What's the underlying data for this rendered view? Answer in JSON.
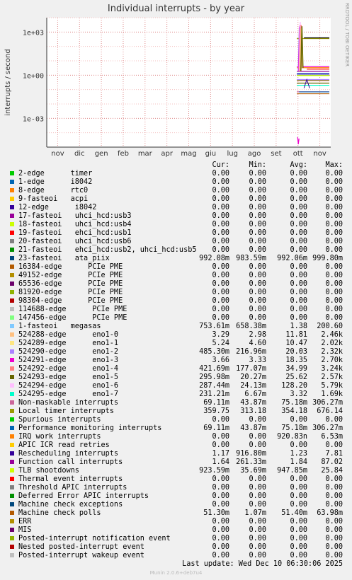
{
  "chart_data": {
    "type": "line",
    "title": "Individual interrupts - by year",
    "ylabel": "interrupts / second",
    "yscale": "log",
    "yticks": [
      "1e+03",
      "1e+00",
      "1e-03"
    ],
    "x_ticks": [
      "nov",
      "dic",
      "gen",
      "feb",
      "mar",
      "apr",
      "mag",
      "giu",
      "lug",
      "ago",
      "set",
      "ott",
      "nov"
    ],
    "grid": true,
    "note": "Data exists only from mid-ott onwards"
  },
  "side_label": "RRDTOOL / TOBI OETIKER",
  "columns": [
    "Cur:",
    "Min:",
    "Avg:",
    "Max:"
  ],
  "legend": [
    {
      "name": "2-edge      timer",
      "color": "#00cc00",
      "cur": "0.00",
      "min": "0.00",
      "avg": "0.00",
      "max": "0.00"
    },
    {
      "name": "1-edge      i8042",
      "color": "#0066b3",
      "cur": "0.00",
      "min": "0.00",
      "avg": "0.00",
      "max": "0.00"
    },
    {
      "name": "8-edge      rtc0",
      "color": "#ff8000",
      "cur": "0.00",
      "min": "0.00",
      "avg": "0.00",
      "max": "0.00"
    },
    {
      "name": "9-fasteoi   acpi",
      "color": "#ffcc00",
      "cur": "0.00",
      "min": "0.00",
      "avg": "0.00",
      "max": "0.00"
    },
    {
      "name": "12-edge      i8042",
      "color": "#330099",
      "cur": "0.00",
      "min": "0.00",
      "avg": "0.00",
      "max": "0.00"
    },
    {
      "name": "17-fasteoi   uhci_hcd:usb3",
      "color": "#990099",
      "cur": "0.00",
      "min": "0.00",
      "avg": "0.00",
      "max": "0.00"
    },
    {
      "name": "18-fasteoi   uhci_hcd:usb4",
      "color": "#ccff00",
      "cur": "0.00",
      "min": "0.00",
      "avg": "0.00",
      "max": "0.00"
    },
    {
      "name": "19-fasteoi   ehci_hcd:usb1",
      "color": "#ff0000",
      "cur": "0.00",
      "min": "0.00",
      "avg": "0.00",
      "max": "0.00"
    },
    {
      "name": "20-fasteoi   uhci_hcd:usb6",
      "color": "#808080",
      "cur": "0.00",
      "min": "0.00",
      "avg": "0.00",
      "max": "0.00"
    },
    {
      "name": "21-fasteoi   ehci_hcd:usb2, uhci_hcd:usb5",
      "color": "#008f00",
      "cur": "0.00",
      "min": "0.00",
      "avg": "0.00",
      "max": "0.00"
    },
    {
      "name": "23-fasteoi   ata_piix",
      "color": "#00487d",
      "cur": "992.08m",
      "min": "983.59m",
      "avg": "992.06m",
      "max": "999.80m"
    },
    {
      "name": "16384-edge      PCIe PME",
      "color": "#b35a00",
      "cur": "0.00",
      "min": "0.00",
      "avg": "0.00",
      "max": "0.00"
    },
    {
      "name": "49152-edge      PCIe PME",
      "color": "#b38f00",
      "cur": "0.00",
      "min": "0.00",
      "avg": "0.00",
      "max": "0.00"
    },
    {
      "name": "65536-edge      PCIe PME",
      "color": "#6b006b",
      "cur": "0.00",
      "min": "0.00",
      "avg": "0.00",
      "max": "0.00"
    },
    {
      "name": "81920-edge      PCIe PME",
      "color": "#8fb300",
      "cur": "0.00",
      "min": "0.00",
      "avg": "0.00",
      "max": "0.00"
    },
    {
      "name": "98304-edge      PCIe PME",
      "color": "#b30000",
      "cur": "0.00",
      "min": "0.00",
      "avg": "0.00",
      "max": "0.00"
    },
    {
      "name": "114688-edge      PCIe PME",
      "color": "#bebebe",
      "cur": "0.00",
      "min": "0.00",
      "avg": "0.00",
      "max": "0.00"
    },
    {
      "name": "147456-edge      PCIe PME",
      "color": "#80ff80",
      "cur": "0.00",
      "min": "0.00",
      "avg": "0.00",
      "max": "0.00"
    },
    {
      "name": "1-fasteoi   megasas",
      "color": "#80c9ff",
      "cur": "753.61m",
      "min": "658.38m",
      "avg": "1.38",
      "max": "200.60"
    },
    {
      "name": "524288-edge      eno1-0",
      "color": "#ffc080",
      "cur": "3.29",
      "min": "2.98",
      "avg": "11.81",
      "max": "2.46k"
    },
    {
      "name": "524289-edge      eno1-1",
      "color": "#ffe680",
      "cur": "5.24",
      "min": "4.60",
      "avg": "10.47",
      "max": "2.02k"
    },
    {
      "name": "524290-edge      eno1-2",
      "color": "#aa80ff",
      "cur": "485.30m",
      "min": "216.96m",
      "avg": "20.03",
      "max": "2.32k"
    },
    {
      "name": "524291-edge      eno1-3",
      "color": "#ee00cc",
      "cur": "3.66",
      "min": "3.33",
      "avg": "18.35",
      "max": "2.70k"
    },
    {
      "name": "524292-edge      eno1-4",
      "color": "#ff8080",
      "cur": "421.69m",
      "min": "177.07m",
      "avg": "34.99",
      "max": "3.24k"
    },
    {
      "name": "524293-edge      eno1-5",
      "color": "#666600",
      "cur": "295.98m",
      "min": "20.27m",
      "avg": "25.62",
      "max": "2.57k"
    },
    {
      "name": "524294-edge      eno1-6",
      "color": "#ffbfff",
      "cur": "287.44m",
      "min": "24.13m",
      "avg": "128.20",
      "max": "5.79k"
    },
    {
      "name": "524295-edge      eno1-7",
      "color": "#00ffcc",
      "cur": "231.21m",
      "min": "6.67m",
      "avg": "3.32",
      "max": "1.69k"
    },
    {
      "name": "Non-maskable interrupts",
      "color": "#cc6699",
      "cur": "69.11m",
      "min": "43.87m",
      "avg": "75.18m",
      "max": "306.27m"
    },
    {
      "name": "Local timer interrupts",
      "color": "#999900",
      "cur": "359.75",
      "min": "313.18",
      "avg": "354.18",
      "max": "676.14"
    },
    {
      "name": "Spurious interrupts",
      "color": "#00cc00",
      "cur": "0.00",
      "min": "0.00",
      "avg": "0.00",
      "max": "0.00"
    },
    {
      "name": "Performance monitoring interrupts",
      "color": "#0066b3",
      "cur": "69.11m",
      "min": "43.87m",
      "avg": "75.18m",
      "max": "306.27m"
    },
    {
      "name": "IRQ work interrupts",
      "color": "#ff8000",
      "cur": "0.00",
      "min": "0.00",
      "avg": "920.83n",
      "max": "6.53m"
    },
    {
      "name": "APIC ICR read retries",
      "color": "#ffcc00",
      "cur": "0.00",
      "min": "0.00",
      "avg": "0.00",
      "max": "0.00"
    },
    {
      "name": "Rescheduling interrupts",
      "color": "#330099",
      "cur": "1.17",
      "min": "916.80m",
      "avg": "1.23",
      "max": "7.81"
    },
    {
      "name": "Function call interrupts",
      "color": "#990099",
      "cur": "1.64",
      "min": "261.33m",
      "avg": "1.84",
      "max": "87.02"
    },
    {
      "name": "TLB shootdowns",
      "color": "#ccff00",
      "cur": "923.59m",
      "min": "35.69m",
      "avg": "947.85m",
      "max": "25.84"
    },
    {
      "name": "Thermal event interrupts",
      "color": "#ff0000",
      "cur": "0.00",
      "min": "0.00",
      "avg": "0.00",
      "max": "0.00"
    },
    {
      "name": "Threshold APIC interrupts",
      "color": "#808080",
      "cur": "0.00",
      "min": "0.00",
      "avg": "0.00",
      "max": "0.00"
    },
    {
      "name": "Deferred Error APIC interrupts",
      "color": "#008f00",
      "cur": "0.00",
      "min": "0.00",
      "avg": "0.00",
      "max": "0.00"
    },
    {
      "name": "Machine check exceptions",
      "color": "#00487d",
      "cur": "0.00",
      "min": "0.00",
      "avg": "0.00",
      "max": "0.00"
    },
    {
      "name": "Machine check polls",
      "color": "#b35a00",
      "cur": "51.30m",
      "min": "1.07m",
      "avg": "51.40m",
      "max": "63.98m"
    },
    {
      "name": "ERR",
      "color": "#b38f00",
      "cur": "0.00",
      "min": "0.00",
      "avg": "0.00",
      "max": "0.00"
    },
    {
      "name": "MIS",
      "color": "#6b006b",
      "cur": "0.00",
      "min": "0.00",
      "avg": "0.00",
      "max": "0.00"
    },
    {
      "name": "Posted-interrupt notification event",
      "color": "#8fb300",
      "cur": "0.00",
      "min": "0.00",
      "avg": "0.00",
      "max": "0.00"
    },
    {
      "name": "Nested posted-interrupt event",
      "color": "#b30000",
      "cur": "0.00",
      "min": "0.00",
      "avg": "0.00",
      "max": "0.00"
    },
    {
      "name": "Posted-interrupt wakeup event",
      "color": "#bebebe",
      "cur": "0.00",
      "min": "0.00",
      "avg": "0.00",
      "max": "0.00"
    }
  ],
  "last_update": "Last update:  Wed Dec 10 06:30:06 2025",
  "munin_version": "Munin 2.0.6+deb7u4"
}
